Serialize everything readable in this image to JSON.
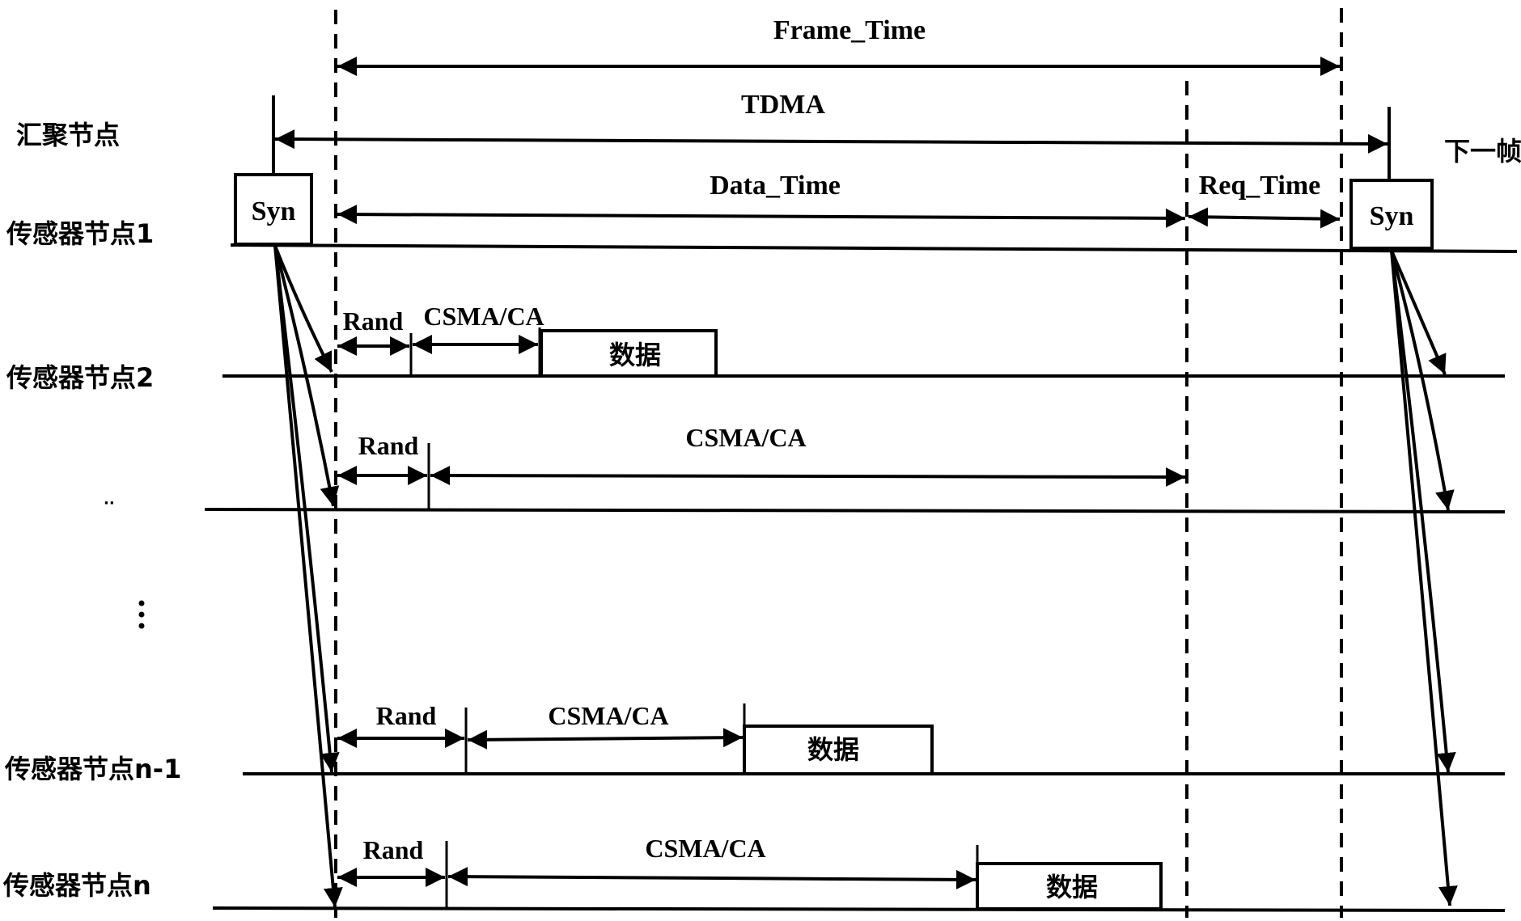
{
  "diagram": {
    "type": "tdma-csma-frame-timing",
    "colors": {
      "ink": "#000000",
      "background": "#ffffff"
    },
    "nodes": {
      "sink": "汇聚节点",
      "sensor1": "传感器节点1",
      "sensor2": "传感器节点2",
      "sensor_n_minus_1": "传感器节点n-1",
      "sensor_n": "传感器节点n",
      "ellipsis_small": "··",
      "ellipsis_vertical": "⋮"
    },
    "intervals": {
      "frame_time": "Frame_Time",
      "tdma": "TDMA",
      "data_time": "Data_Time",
      "req_time": "Req_Time"
    },
    "next_frame": "下一帧",
    "syn_label": "Syn",
    "rand_label": "Rand",
    "csma_label": "CSMA/CA",
    "data_label": "数据",
    "rows": [
      {
        "node": "sensor2",
        "rand": "Rand",
        "csma": "CSMA/CA",
        "data": "数据",
        "has_data": true
      },
      {
        "node": "ellipsis_small",
        "rand": "Rand",
        "csma": "CSMA/CA",
        "data": "",
        "has_data": false
      },
      {
        "node": "sensor_n_minus_1",
        "rand": "Rand",
        "csma": "CSMA/CA",
        "data": "数据",
        "has_data": true
      },
      {
        "node": "sensor_n",
        "rand": "Rand",
        "csma": "CSMA/CA",
        "data": "数据",
        "has_data": true
      }
    ]
  }
}
